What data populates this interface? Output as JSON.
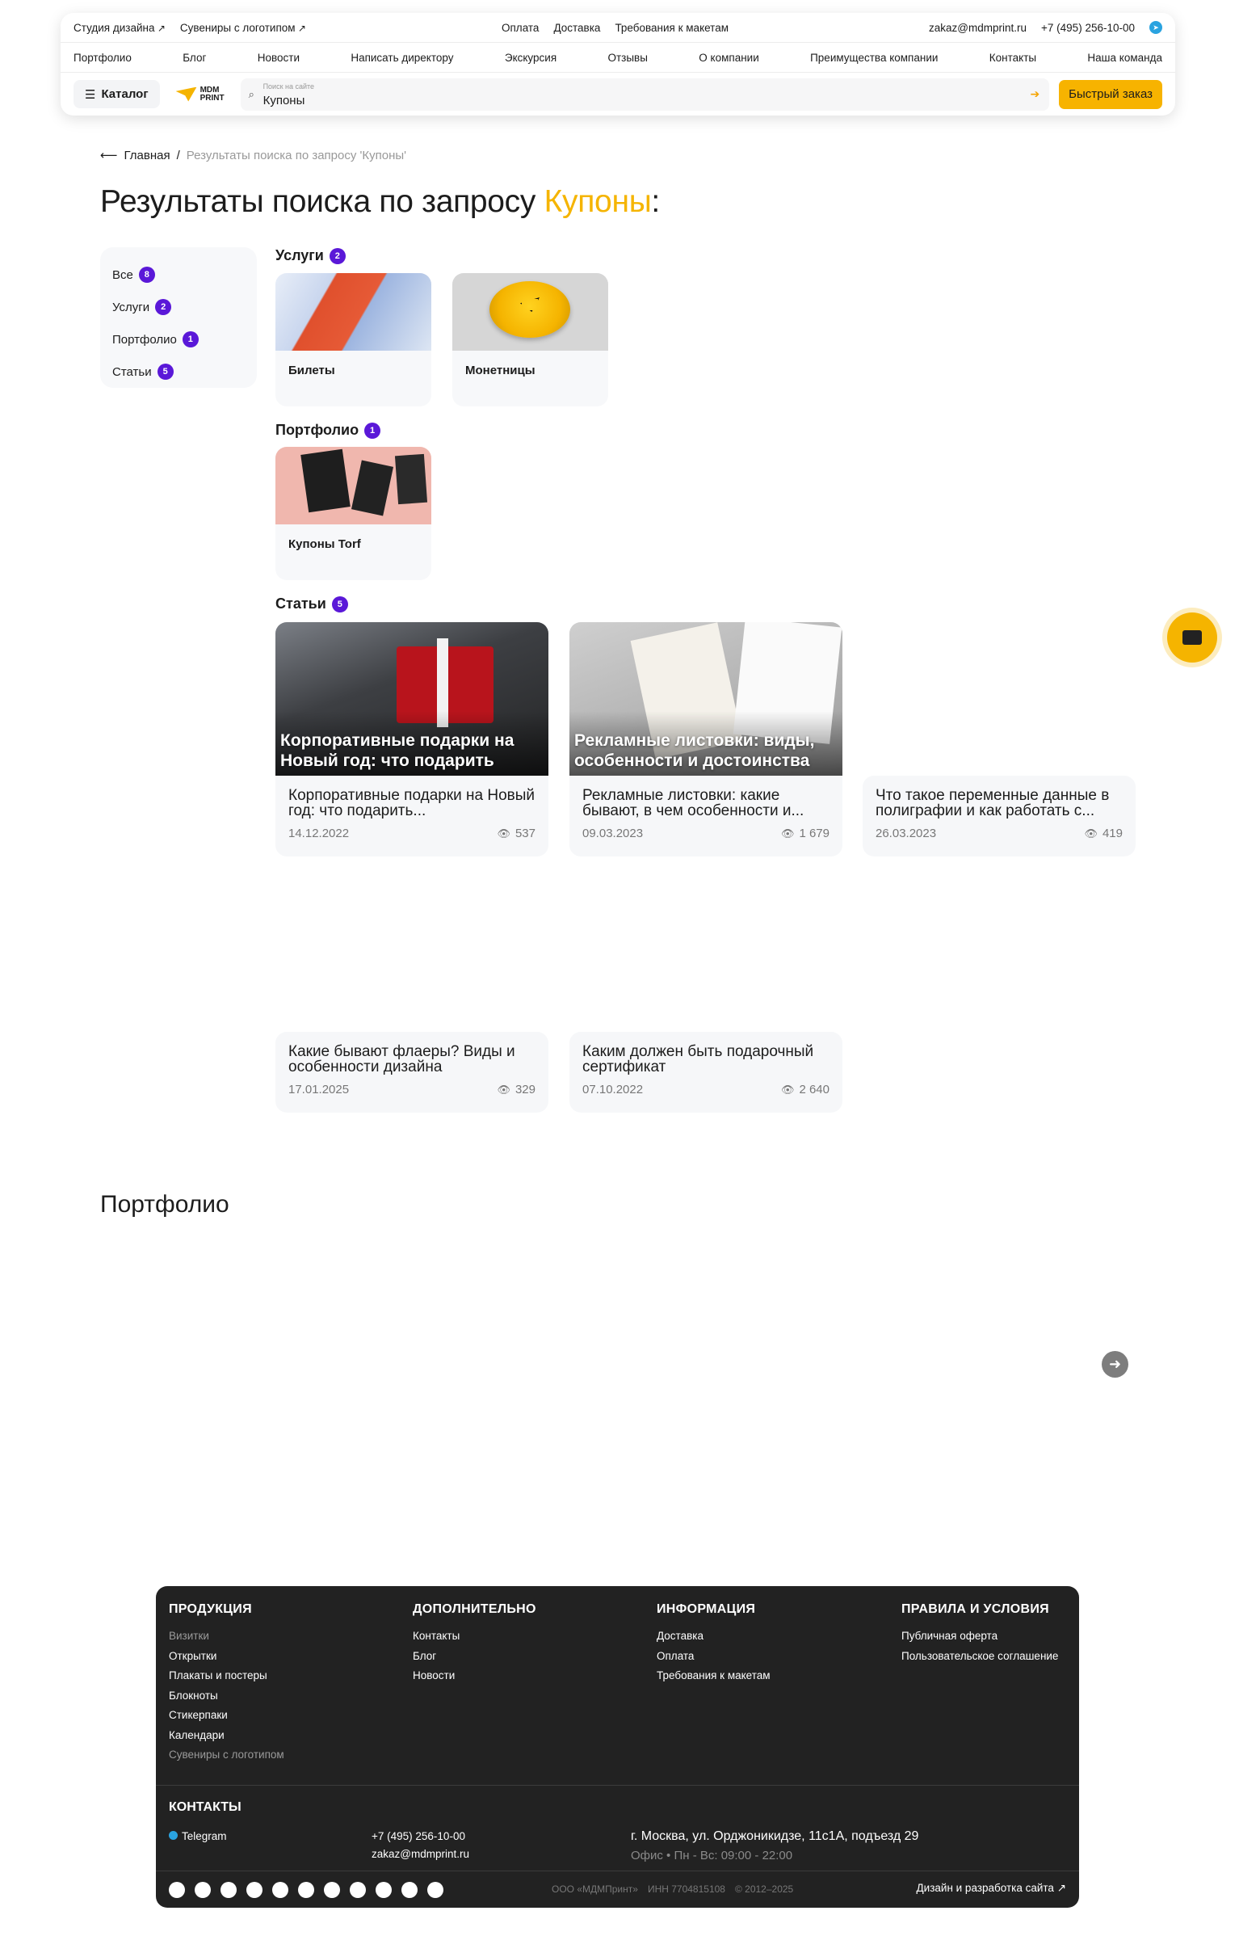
{
  "topbar": {
    "left_links": [
      "Студия дизайна",
      "Сувениры с логотипом"
    ],
    "center_links": [
      "Оплата",
      "Доставка",
      "Требования к макетам"
    ],
    "email": "zakaz@mdmprint.ru",
    "phone": "+7 (495) 256-10-00"
  },
  "nav": [
    "Портфолио",
    "Блог",
    "Новости",
    "Написать директору",
    "Экскурсия",
    "Отзывы",
    "О компании",
    "Преимущества компании",
    "Контакты",
    "Наша команда"
  ],
  "catalog_label": "Каталог",
  "logo": {
    "line1": "MDM",
    "line2": "PRINT"
  },
  "search": {
    "placeholder": "Поиск на сайте",
    "value": "Купоны"
  },
  "quick_order": "Быстрый заказ",
  "breadcrumb": {
    "home": "Главная",
    "sep": "/",
    "current": "Результаты поиска по запросу 'Купоны'"
  },
  "title": {
    "prefix": "Результаты поиска по запросу ",
    "query": "Купоны",
    "suffix": ":"
  },
  "filters": [
    {
      "label": "Все",
      "count": "8"
    },
    {
      "label": "Услуги",
      "count": "2"
    },
    {
      "label": "Портфолио",
      "count": "1"
    },
    {
      "label": "Статьи",
      "count": "5"
    }
  ],
  "services": {
    "label": "Услуги",
    "count": "2",
    "items": [
      "Билеты",
      "Монетницы"
    ]
  },
  "portfolio": {
    "label": "Портфолио",
    "count": "1",
    "items": [
      "Купоны Torf"
    ]
  },
  "articles": {
    "label": "Статьи",
    "count": "5",
    "items": [
      {
        "overlay": "Корпоративные подарки на Новый год: что подарить",
        "title": "Корпоративные подарки на Новый год: что подарить...",
        "date": "14.12.2022",
        "views": "537"
      },
      {
        "overlay": "Рекламные листовки: виды, особенности и достоинства",
        "title": "Рекламные листовки: какие бывают, в чем особенности и...",
        "date": "09.03.2023",
        "views": "1 679"
      },
      {
        "overlay": "",
        "title": "Что такое переменные данные в полиграфии и как работать с...",
        "date": "26.03.2023",
        "views": "419"
      },
      {
        "overlay": "",
        "title": "Какие бывают флаеры? Виды и особенности дизайна",
        "date": "17.01.2025",
        "views": "329"
      },
      {
        "overlay": "",
        "title": "Каким должен быть подарочный сертификат",
        "date": "07.10.2022",
        "views": "2 640"
      }
    ]
  },
  "portfolio_section_title": "Портфолио",
  "footer": {
    "cols": [
      {
        "title": "ПРОДУКЦИЯ",
        "links": [
          "Визитки",
          "Открытки",
          "Плакаты и постеры",
          "Блокноты",
          "Стикерпаки",
          "Календари",
          "Сувениры с логотипом"
        ]
      },
      {
        "title": "ДОПОЛНИТЕЛЬНО",
        "links": [
          "Контакты",
          "Блог",
          "Новости"
        ]
      },
      {
        "title": "ИНФОРМАЦИЯ",
        "links": [
          "Доставка",
          "Оплата",
          "Требования к макетам"
        ]
      },
      {
        "title": "ПРАВИЛА И УСЛОВИЯ",
        "links": [
          "Публичная оферта",
          "Пользовательское соглашение"
        ]
      }
    ],
    "contacts_title": "КОНТАКТЫ",
    "telegram": "Telegram",
    "phone": "+7 (495) 256-10-00",
    "email": "zakaz@mdmprint.ru",
    "address": "г. Москва, ул. Орджоникидзе, 11с1А, подъезд 29",
    "hours": "Офис • Пн - Вс: 09:00 - 22:00",
    "company": "ООО «МДМПринт»",
    "inn": "ИНН 7704815108",
    "years": "© 2012–2025",
    "dev": "Дизайн и разработка сайта"
  }
}
